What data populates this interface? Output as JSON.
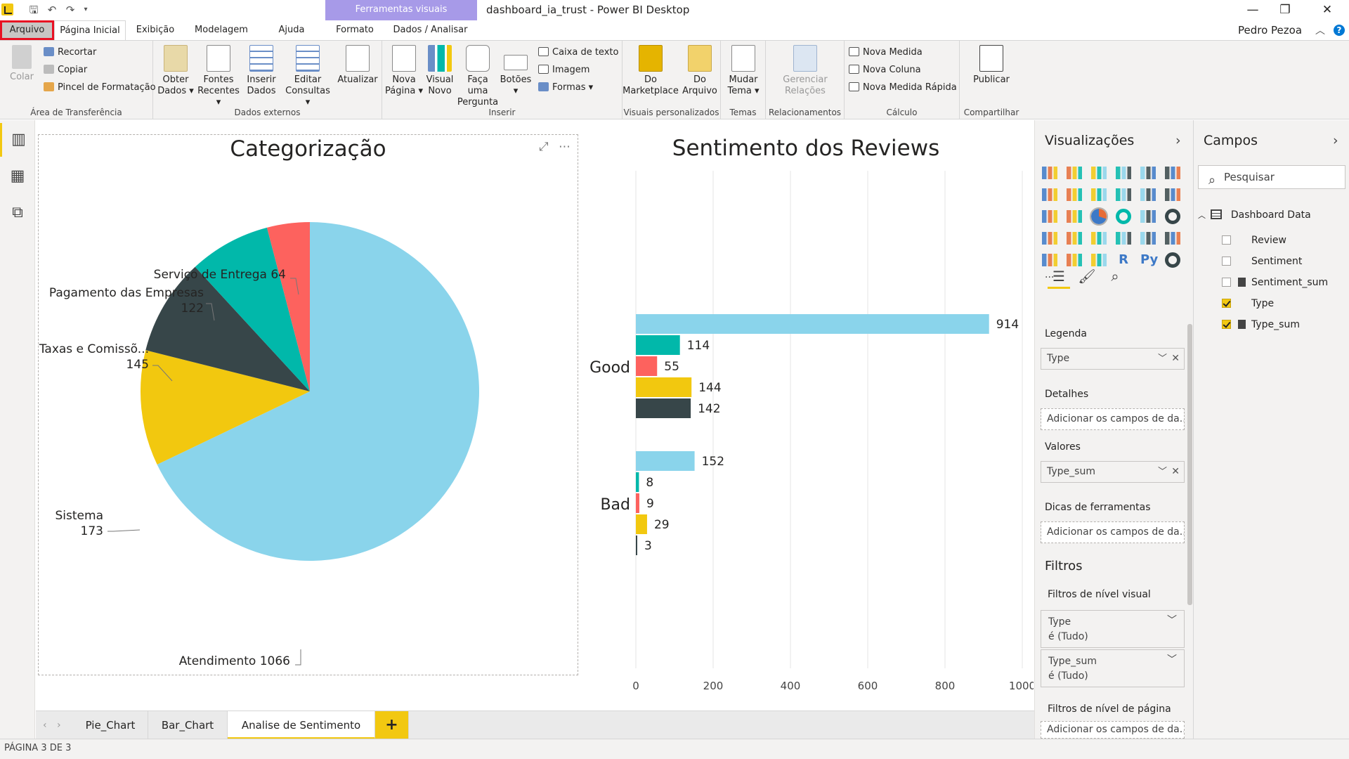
{
  "window": {
    "title": "dashboard_ia_trust - Power BI Desktop",
    "tools_header": "Ferramentas visuais",
    "minimize": "—",
    "maximize": "❐",
    "close": "✕",
    "user": "Pedro Pezoa",
    "help": "?"
  },
  "tabs": [
    "Arquivo",
    "Página Inicial",
    "Exibição",
    "Modelagem",
    "Ajuda",
    "Formato",
    "Dados / Analisar"
  ],
  "ribbon": {
    "clipboard": {
      "paste": "Colar",
      "cut": "Recortar",
      "copy": "Copiar",
      "format_painter": "Pincel de Formatação",
      "label": "Área de Transferência"
    },
    "external": {
      "get_data": [
        "Obter",
        "Dados ▾"
      ],
      "recent": [
        "Fontes",
        "Recentes ▾"
      ],
      "enter": [
        "Inserir",
        "Dados"
      ],
      "edit": [
        "Editar",
        "Consultas ▾"
      ],
      "refresh": "Atualizar",
      "label": "Dados externos"
    },
    "insert": {
      "new_page": [
        "Nova",
        "Página ▾"
      ],
      "new_visual": [
        "Visual",
        "Novo"
      ],
      "ask": [
        "Faça uma",
        "Pergunta"
      ],
      "buttons": [
        "Botões",
        "▾"
      ],
      "textbox": "Caixa de texto",
      "image": "Imagem",
      "shapes": "Formas ▾",
      "label": "Inserir"
    },
    "custom": {
      "marketplace": [
        "Do",
        "Marketplace"
      ],
      "file": [
        "Do",
        "Arquivo"
      ],
      "label": "Visuais personalizados"
    },
    "themes": {
      "switch": [
        "Mudar",
        "Tema ▾"
      ],
      "label": "Temas"
    },
    "relations": {
      "manage": [
        "Gerenciar",
        "Relações"
      ],
      "label": "Relacionamentos"
    },
    "calc": {
      "measure": "Nova Medida",
      "column": "Nova Coluna",
      "quick": "Nova Medida Rápida",
      "label": "Cálculo"
    },
    "share": {
      "publish": "Publicar",
      "label": "Compartilhar"
    }
  },
  "colors": {
    "sky": "#8ad4eb",
    "teal": "#01b8aa",
    "red": "#fd625e",
    "yellow": "#f2c80f",
    "dark": "#374649"
  },
  "pie": {
    "title": "Categorização",
    "slices": [
      {
        "label": "Atendimento 1066",
        "value": 1066,
        "color": "#8ad4eb"
      },
      {
        "label": "Sistema\n173",
        "value": 173,
        "color": "#f2c80f"
      },
      {
        "label": "Taxas e Comissõ...\n145",
        "value": 145,
        "color": "#374649"
      },
      {
        "label": "Pagamento das Empresas\n122",
        "value": 122,
        "color": "#01b8aa"
      },
      {
        "label": "Serviço de Entrega 64",
        "value": 64,
        "color": "#fd625e"
      }
    ]
  },
  "chart_data": {
    "type": "bar",
    "title": "Sentimento dos Reviews",
    "categories": [
      "Good",
      "Bad"
    ],
    "series": [
      {
        "values": [
          914,
          152
        ],
        "color": "#8ad4eb"
      },
      {
        "values": [
          114,
          8
        ],
        "color": "#01b8aa"
      },
      {
        "values": [
          55,
          9
        ],
        "color": "#fd625e"
      },
      {
        "values": [
          144,
          29
        ],
        "color": "#f2c80f"
      },
      {
        "values": [
          142,
          3
        ],
        "color": "#374649"
      }
    ],
    "xlim": [
      0,
      1000
    ],
    "xticks": [
      "0",
      "200",
      "400",
      "600",
      "800",
      "1000"
    ],
    "grid": true,
    "orientation": "horizontal"
  },
  "pages": {
    "tabs": [
      "Pie_Chart",
      "Bar_Chart",
      "Analise de Sentimento"
    ],
    "add": "+",
    "status": "PÁGINA 3 DE 3"
  },
  "viz_pane": {
    "title": "Visualizações",
    "more": "...",
    "legend_label": "Legenda",
    "legend_value": "Type",
    "details_label": "Detalhes",
    "details_placeholder": "Adicionar os campos de da...",
    "values_label": "Valores",
    "values_value": "Type_sum",
    "tooltips_label": "Dicas de ferramentas",
    "tooltips_placeholder": "Adicionar os campos de da...",
    "filters_title": "Filtros",
    "visual_filters_label": "Filtros de nível visual",
    "filter1_name": "Type",
    "filter1_value": "é (Tudo)",
    "filter2_name": "Type_sum",
    "filter2_value": "é (Tudo)",
    "page_filters_label": "Filtros de nível de página",
    "page_filters_placeholder": "Adicionar os campos de da..."
  },
  "fields_pane": {
    "title": "Campos",
    "search_placeholder": "Pesquisar",
    "table": "Dashboard Data",
    "fields": [
      {
        "name": "Review",
        "checked": false,
        "calc": false
      },
      {
        "name": "Sentiment",
        "checked": false,
        "calc": false
      },
      {
        "name": "Sentiment_sum",
        "checked": false,
        "calc": true
      },
      {
        "name": "Type",
        "checked": true,
        "calc": false
      },
      {
        "name": "Type_sum",
        "checked": true,
        "calc": true
      }
    ]
  }
}
